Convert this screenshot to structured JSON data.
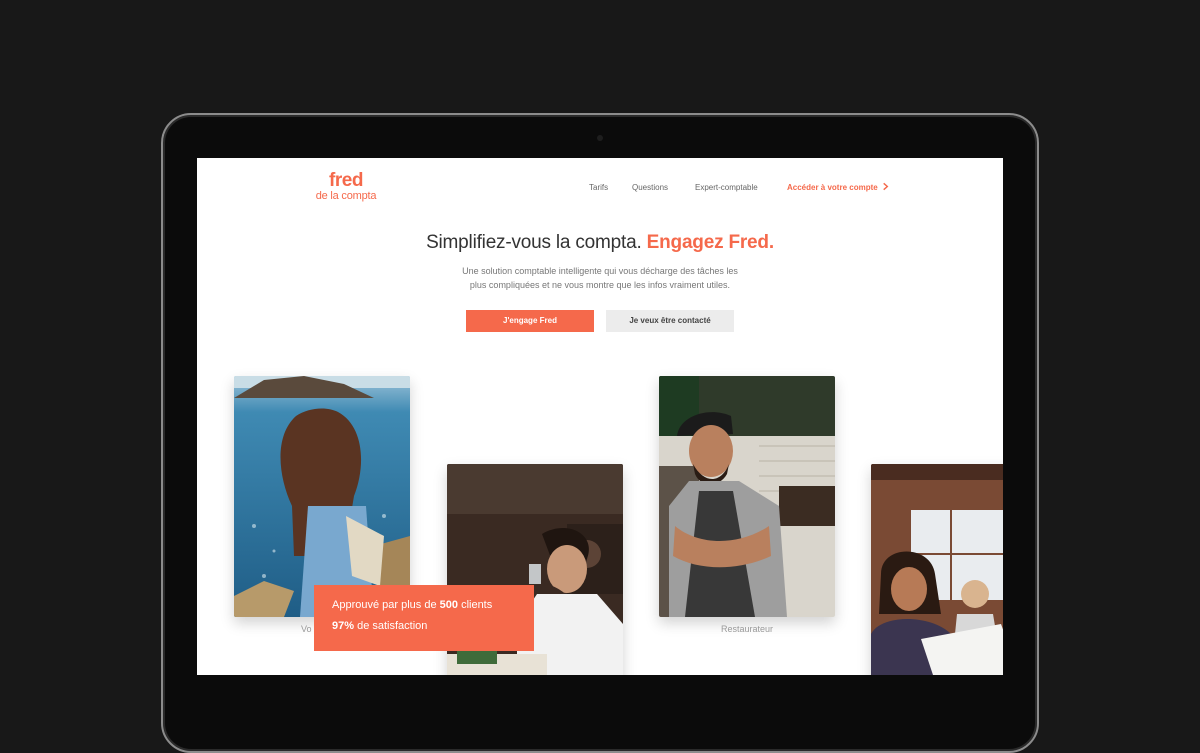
{
  "brand": {
    "logo_main": "fred",
    "logo_sub": "de la compta",
    "accent_color": "#f5694b"
  },
  "nav": {
    "items": [
      "Tarifs",
      "Questions",
      "Expert-comptable"
    ],
    "cta_label": "Accéder à votre compte",
    "cta_icon": "chevron-right-icon"
  },
  "hero": {
    "headline": "Simplifiez-vous la compta.",
    "headline_accent": "Engagez Fred.",
    "subtext_line1": "Une solution comptable intelligente qui vous décharge des tâches les",
    "subtext_line2": "plus compliquées et ne vous montre que les infos vraiment utiles.",
    "primary_button": "J'engage Fred",
    "secondary_button": "Je veux être contacté"
  },
  "cards": [
    {
      "caption": "Vo",
      "photo": "woman-by-the-sea"
    },
    {
      "caption": "",
      "photo": "man-drinking-at-desk"
    },
    {
      "caption": "Restaurateur",
      "photo": "smiling-barista-with-apron"
    },
    {
      "caption": "",
      "photo": "woman-reading-papers-in-office"
    }
  ],
  "badge": {
    "line1_prefix": "Approuvé par plus de",
    "line1_value": "500",
    "line1_suffix": "clients",
    "line2_value": "97%",
    "line2_suffix": "de satisfaction"
  }
}
